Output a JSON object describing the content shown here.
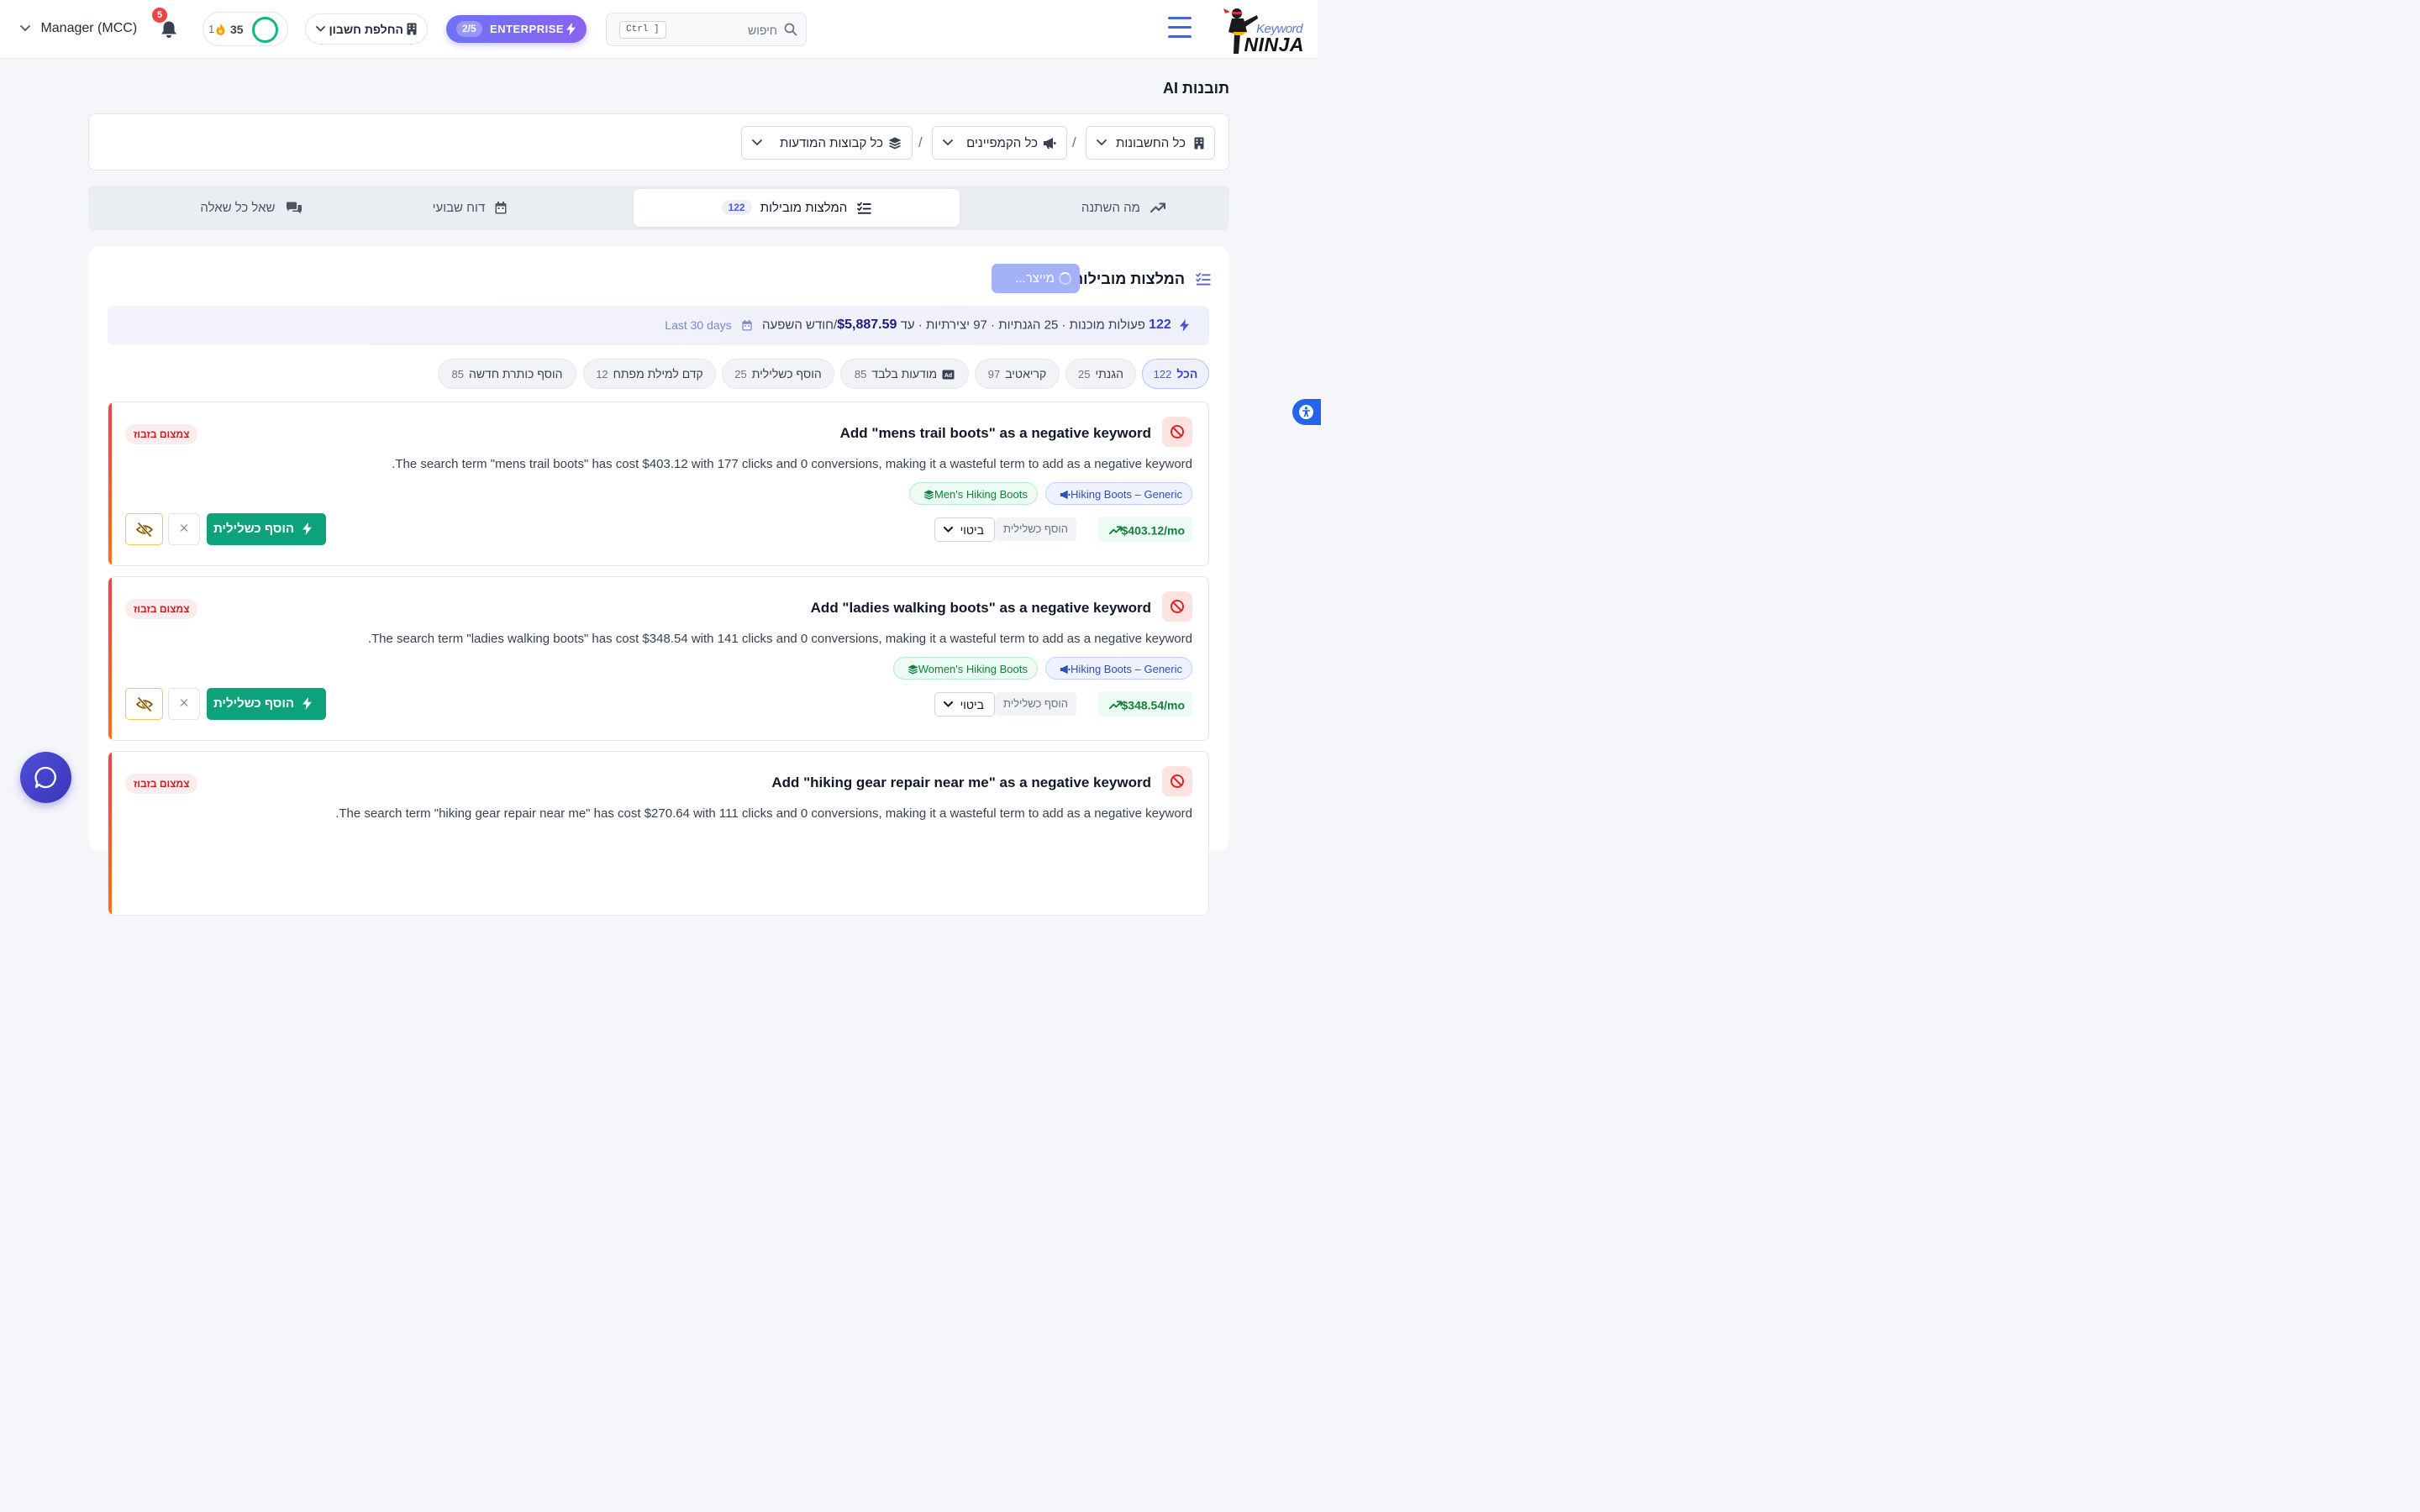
{
  "header": {
    "logo_kw": "Keyword",
    "logo_ninja": "NINJA",
    "search_placeholder": "חיפוש",
    "search_shortcut": "Ctrl ]",
    "plan_badge": "2/5",
    "plan_label": "ENTERPRISE",
    "account_switch_label": "החלפת חשבון",
    "score": "35",
    "streak": "1",
    "notifications_count": "5",
    "user_menu_label": "Manager (MCC)"
  },
  "page": {
    "title": "תובנות AI"
  },
  "filters": {
    "accounts": "כל החשבונות",
    "campaigns": "כל הקמפיינים",
    "ad_groups": "כל קבוצות המודעות",
    "separator": "/"
  },
  "tabs": [
    {
      "label": "מה השתנה"
    },
    {
      "label": "המלצות מובילות",
      "count": "122"
    },
    {
      "label": "דוח שבועי"
    },
    {
      "label": "שאל כל שאלה"
    }
  ],
  "section": {
    "title": "המלצות מובילות",
    "generating_label": "מייצר...",
    "summary": {
      "count": "122",
      "text": "פעולות מוכנות · 25 הגנתיות · 97 יצירתיות · עד",
      "money": "$5,887.59",
      "suffix": "/חודש השפעה",
      "period": "Last 30 days"
    }
  },
  "filter_chips": [
    {
      "label": "הכל",
      "count": "122"
    },
    {
      "label": "הגנתי",
      "count": "25"
    },
    {
      "label": "קריאטיב",
      "count": "97"
    },
    {
      "label": "מודעות בלבד",
      "count": "85"
    },
    {
      "label": "הוסף כשלילית",
      "count": "25"
    },
    {
      "label": "קדם למילת מפתח",
      "count": "12"
    },
    {
      "label": "הוסף כותרת חדשה",
      "count": "85"
    }
  ],
  "recommendations": [
    {
      "title": "Add \"mens trail boots\" as a negative keyword",
      "description": "The search term \"mens trail boots\" has cost $403.12 with 177 clicks and 0 conversions, making it a wasteful term to add as a negative keyword.",
      "campaign": "Hiking Boots – Generic",
      "ad_group": "Men's Hiking Boots",
      "badge": "צמצום בזבוז",
      "impact": "$403.12/mo",
      "action_type": "הוסף כשלילית",
      "match_type": "ביטוי",
      "apply_label": "הוסף כשלילית",
      "dismiss_label": "×"
    },
    {
      "title": "Add \"ladies walking boots\" as a negative keyword",
      "description": "The search term \"ladies walking boots\" has cost $348.54 with 141 clicks and 0 conversions, making it a wasteful term to add as a negative keyword.",
      "campaign": "Hiking Boots – Generic",
      "ad_group": "Women's Hiking Boots",
      "badge": "צמצום בזבוז",
      "impact": "$348.54/mo",
      "action_type": "הוסף כשלילית",
      "match_type": "ביטוי",
      "apply_label": "הוסף כשלילית",
      "dismiss_label": "×"
    },
    {
      "title": "Add \"hiking gear repair near me\" as a negative keyword",
      "description": "The search term \"hiking gear repair near me\" has cost $270.64 with 111 clicks and 0 conversions, making it a wasteful term to add as a negative keyword.",
      "badge": "צמצום בזבוז"
    }
  ],
  "colors": {
    "brand": "#4b63d8",
    "apply": "#0ea27a",
    "danger": "#ef4444",
    "success": "#15803d"
  }
}
